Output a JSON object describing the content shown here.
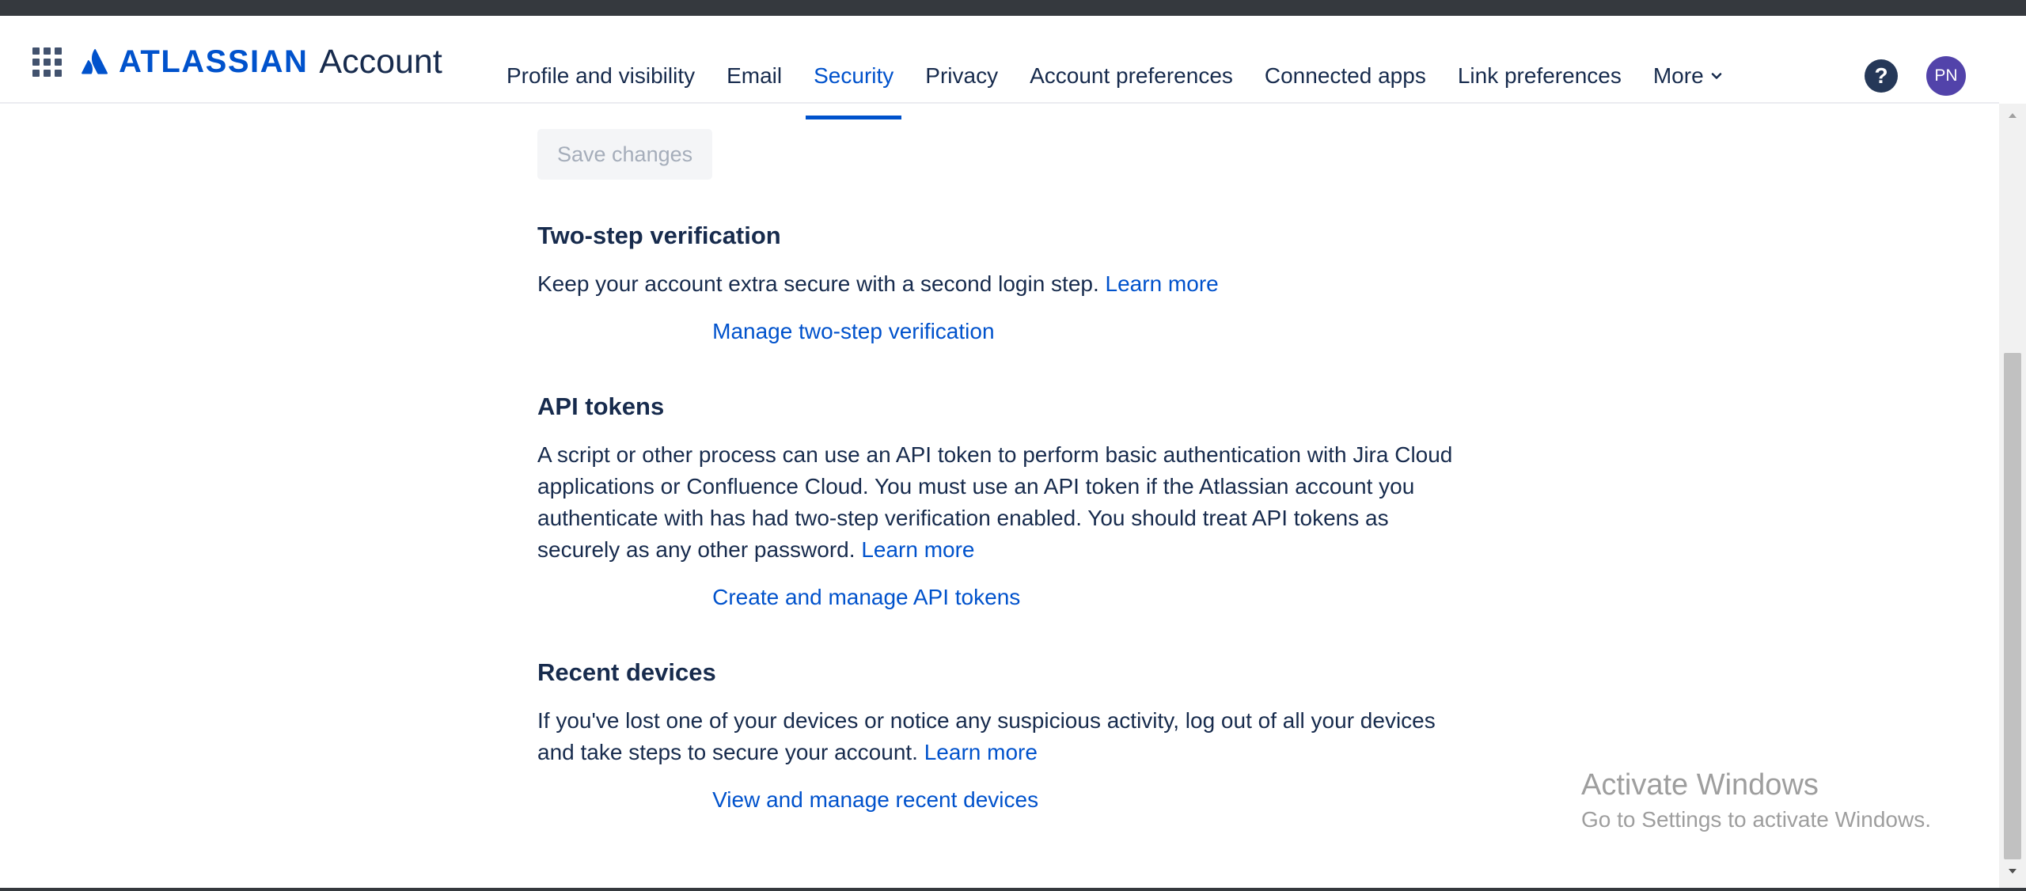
{
  "header": {
    "brand": "ATLASSIAN",
    "product": "Account",
    "nav": [
      {
        "label": "Profile and visibility"
      },
      {
        "label": "Email"
      },
      {
        "label": "Security",
        "active": true
      },
      {
        "label": "Privacy"
      },
      {
        "label": "Account preferences"
      },
      {
        "label": "Connected apps"
      },
      {
        "label": "Link preferences"
      },
      {
        "label": "More"
      }
    ],
    "help": "?",
    "avatar_initials": "PN"
  },
  "main": {
    "save_label": "Save changes",
    "sections": [
      {
        "title": "Two-step verification",
        "desc": "Keep your account extra secure with a second login step.",
        "learn_more": "Learn more",
        "action": "Manage two-step verification"
      },
      {
        "title": "API tokens",
        "desc": "A script or other process can use an API token to perform basic authentication with Jira Cloud applications or Confluence Cloud. You must use an API token if the Atlassian account you authenticate with has had two-step verification enabled. You should treat API tokens as securely as any other password.",
        "learn_more": "Learn more",
        "action": "Create and manage API tokens"
      },
      {
        "title": "Recent devices",
        "desc": "If you've lost one of your devices or notice any suspicious activity, log out of all your devices and take steps to secure your account.",
        "learn_more": "Learn more",
        "action": "View and manage recent devices"
      }
    ]
  },
  "watermark": {
    "title": "Activate Windows",
    "subtitle": "Go to Settings to activate Windows."
  },
  "colors": {
    "brand_blue": "#0052cc",
    "text": "#172b4d",
    "avatar": "#5243aa"
  }
}
